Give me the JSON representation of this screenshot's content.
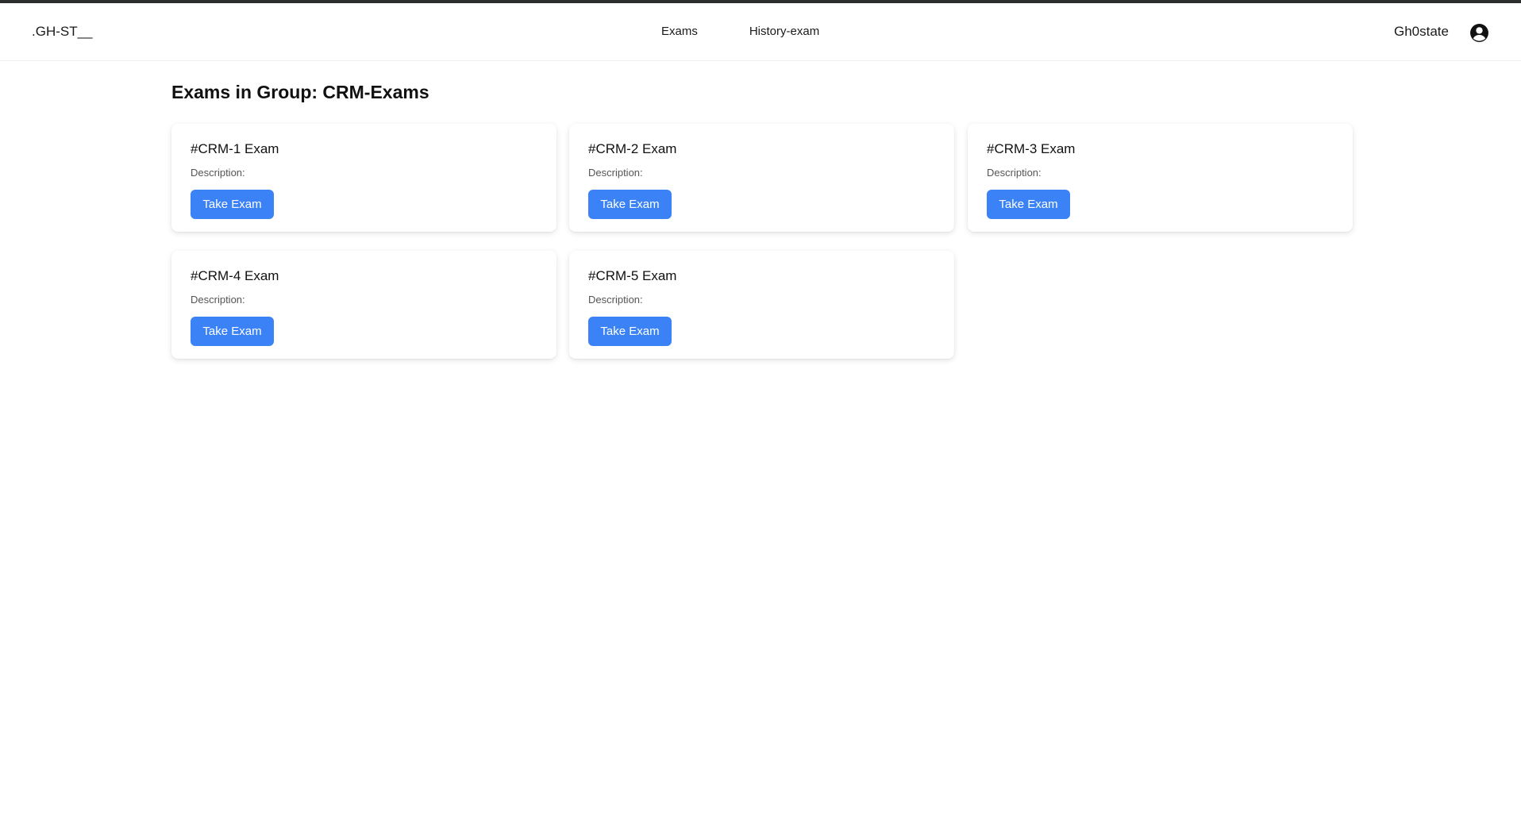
{
  "nav": {
    "brand": ".GH-ST__",
    "links": [
      "Exams",
      "History-exam"
    ],
    "user_name": "Gh0state",
    "avatar_icon": "user-circle-icon"
  },
  "page": {
    "title": "Exams in Group: CRM-Exams"
  },
  "exams": [
    {
      "title": "#CRM-1 Exam",
      "description": "Description:",
      "button": "Take Exam"
    },
    {
      "title": "#CRM-2 Exam",
      "description": "Description:",
      "button": "Take Exam"
    },
    {
      "title": "#CRM-3 Exam",
      "description": "Description:",
      "button": "Take Exam"
    },
    {
      "title": "#CRM-4 Exam",
      "description": "Description:",
      "button": "Take Exam"
    },
    {
      "title": "#CRM-5 Exam",
      "description": "Description:",
      "button": "Take Exam"
    }
  ],
  "colors": {
    "accent": "#3b82f6",
    "top_strip": "#2b2e2d"
  }
}
